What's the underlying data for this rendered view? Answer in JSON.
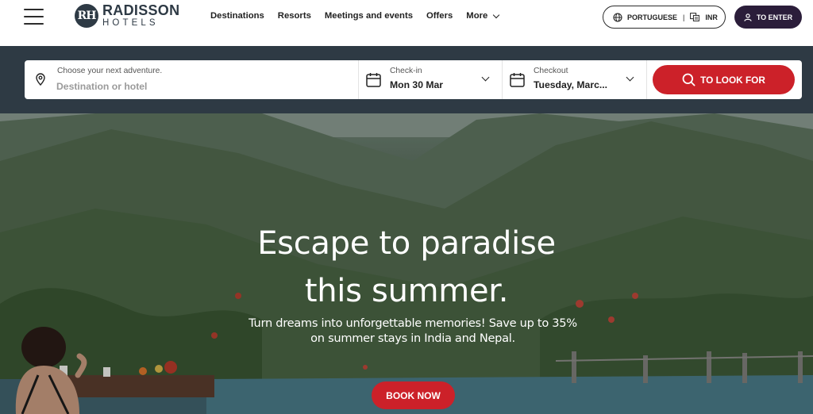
{
  "header": {
    "logo_line1": "RADISSON",
    "logo_line2": "HOTELS",
    "logo_mark": "RH",
    "nav": [
      {
        "label": "Destinations"
      },
      {
        "label": "Resorts"
      },
      {
        "label": "Meetings and events"
      },
      {
        "label": "Offers"
      },
      {
        "label": "More"
      }
    ],
    "language": "PORTUGUESE",
    "currency": "INR",
    "enter_label": "TO ENTER"
  },
  "search": {
    "destination_hint": "Choose your next adventure.",
    "destination_placeholder": "Destination or hotel",
    "checkin_label": "Check-in",
    "checkin_value": "Mon 30 Mar",
    "checkout_label": "Checkout",
    "checkout_value": "Tuesday, Marc...",
    "button_label": "TO LOOK FOR"
  },
  "hero": {
    "title_line1": "Escape to paradise",
    "title_line2": "this summer.",
    "subtitle_line1": "Turn dreams into unforgettable memories! Save up to 35%",
    "subtitle_line2": "on summer stays in India and Nepal.",
    "cta": "BOOK NOW"
  },
  "colors": {
    "brand_red": "#cc2129",
    "brand_dark": "#2e3a44",
    "enter_button": "#2b1d3a"
  },
  "icons": [
    "menu-icon",
    "globe-icon",
    "currency-icon",
    "user-icon",
    "map-pin-icon",
    "calendar-icon",
    "chevron-down-icon",
    "search-icon"
  ]
}
